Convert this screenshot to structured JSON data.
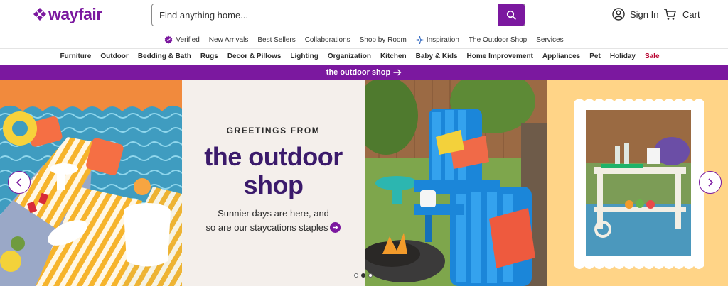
{
  "brand": {
    "name": "wayfair",
    "color": "#7b189f"
  },
  "search": {
    "placeholder": "Find anything home...",
    "icon": "search-icon"
  },
  "account": {
    "sign_in_label": "Sign In",
    "cart_label": "Cart"
  },
  "subnav": [
    {
      "label": "Verified",
      "icon": "verified-badge-icon"
    },
    {
      "label": "New Arrivals"
    },
    {
      "label": "Best Sellers"
    },
    {
      "label": "Collaborations"
    },
    {
      "label": "Shop by Room"
    },
    {
      "label": "Inspiration",
      "icon": "sparkle-icon"
    },
    {
      "label": "The Outdoor Shop"
    },
    {
      "label": "Services"
    }
  ],
  "categories": [
    "Furniture",
    "Outdoor",
    "Bedding & Bath",
    "Rugs",
    "Decor & Pillows",
    "Lighting",
    "Organization",
    "Kitchen",
    "Baby & Kids",
    "Home Improvement",
    "Appliances",
    "Pet",
    "Holiday",
    "Sale"
  ],
  "promo": {
    "label": "the outdoor shop",
    "icon": "arrow-right-icon"
  },
  "hero": {
    "eyebrow": "GREETINGS FROM",
    "headline_line1": "the outdoor",
    "headline_line2": "shop",
    "body_line1": "Sunnier days are here, and",
    "body_line2": "so are our staycations staples",
    "slides_total": 3,
    "active_slide": 2
  },
  "colors": {
    "accent": "#7b189f",
    "sale": "#b8002e",
    "headline": "#3b1a6b"
  }
}
